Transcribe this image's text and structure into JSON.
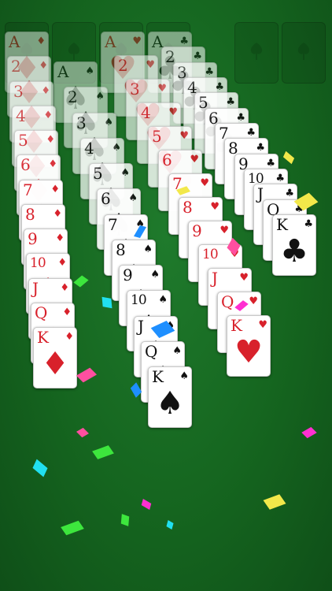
{
  "board": {
    "background": "#1a6e26",
    "empty_slot_icon": "leaf-icon",
    "empty_slot_count": 6
  },
  "suits": {
    "hearts": "♥",
    "diamonds": "♦",
    "clubs": "♣",
    "spades": "♠"
  },
  "colors": {
    "red": "#d8212b",
    "black": "#111111"
  },
  "columns": [
    {
      "suit": "diamonds",
      "color": "red",
      "ranks": [
        "A",
        "2",
        "3",
        "4",
        "5",
        "6",
        "7",
        "8",
        "9",
        "10",
        "J",
        "Q",
        "K"
      ]
    },
    {
      "suit": "spades",
      "color": "black",
      "ranks": [
        "A",
        "2",
        "3",
        "4",
        "5",
        "6",
        "7",
        "8",
        "9",
        "10",
        "J",
        "Q",
        "K"
      ]
    },
    {
      "suit": "hearts",
      "color": "red",
      "ranks": [
        "A",
        "2",
        "3",
        "4",
        "5",
        "6",
        "7",
        "8",
        "9",
        "10",
        "J",
        "Q",
        "K"
      ]
    },
    {
      "suit": "clubs",
      "color": "black",
      "ranks": [
        "A",
        "2",
        "3",
        "4",
        "5",
        "6",
        "7",
        "8",
        "9",
        "10",
        "J",
        "Q",
        "K"
      ]
    }
  ],
  "confetti_colors": [
    "#ff2fd1",
    "#21e0f0",
    "#3de63d",
    "#f2e84a",
    "#1e8fff",
    "#ff4fa0"
  ]
}
